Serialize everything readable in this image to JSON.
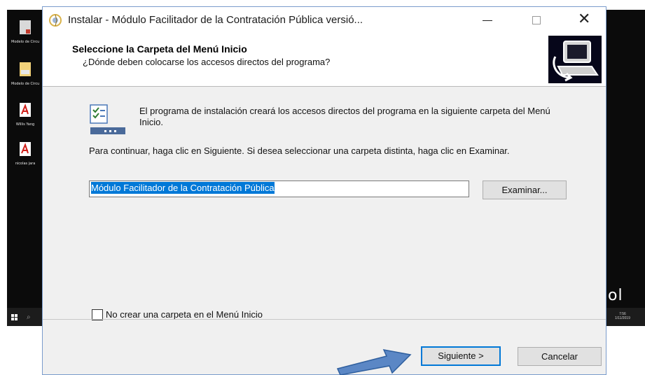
{
  "desktop": {
    "icons": [
      {
        "label": "Modelo de Circular_presu",
        "icon": "document-icon"
      },
      {
        "label": "Modelo de Circular_presu",
        "icon": "document-icon"
      },
      {
        "label": "Willis Yang",
        "icon": "pdf-icon"
      },
      {
        "label": "nicolas jara",
        "icon": "pdf-icon"
      }
    ],
    "brand_fragment": "ol",
    "clock_time": "7:56",
    "clock_date": "1/11/2019"
  },
  "window": {
    "title": "Instalar - Módulo Facilitador de la Contratación Pública versió...",
    "controls": {
      "minimize": "minimize",
      "maximize": "maximize",
      "close": "✕"
    }
  },
  "header": {
    "title": "Seleccione la Carpeta del Menú Inicio",
    "subtitle": "¿Dónde deben colocarse los accesos directos del programa?"
  },
  "body": {
    "intro": "El programa de instalación creará los accesos directos del programa en la siguiente carpeta del Menú Inicio.",
    "instructions": "Para continuar, haga clic en Siguiente. Si desea seleccionar una carpeta distinta, haga clic en Examinar.",
    "folder_value": "Módulo Facilitador de la Contratación Pública",
    "browse_label": "Examinar...",
    "no_folder_label": "No crear una carpeta en el Menú Inicio",
    "no_folder_checked": false
  },
  "footer": {
    "next_label": "Siguiente >",
    "cancel_label": "Cancelar"
  },
  "colors": {
    "accent": "#0078d7",
    "arrow": "#5b87c5",
    "dialog_bg": "#f0f0f0",
    "desktop_bg": "#0b0b0b"
  }
}
